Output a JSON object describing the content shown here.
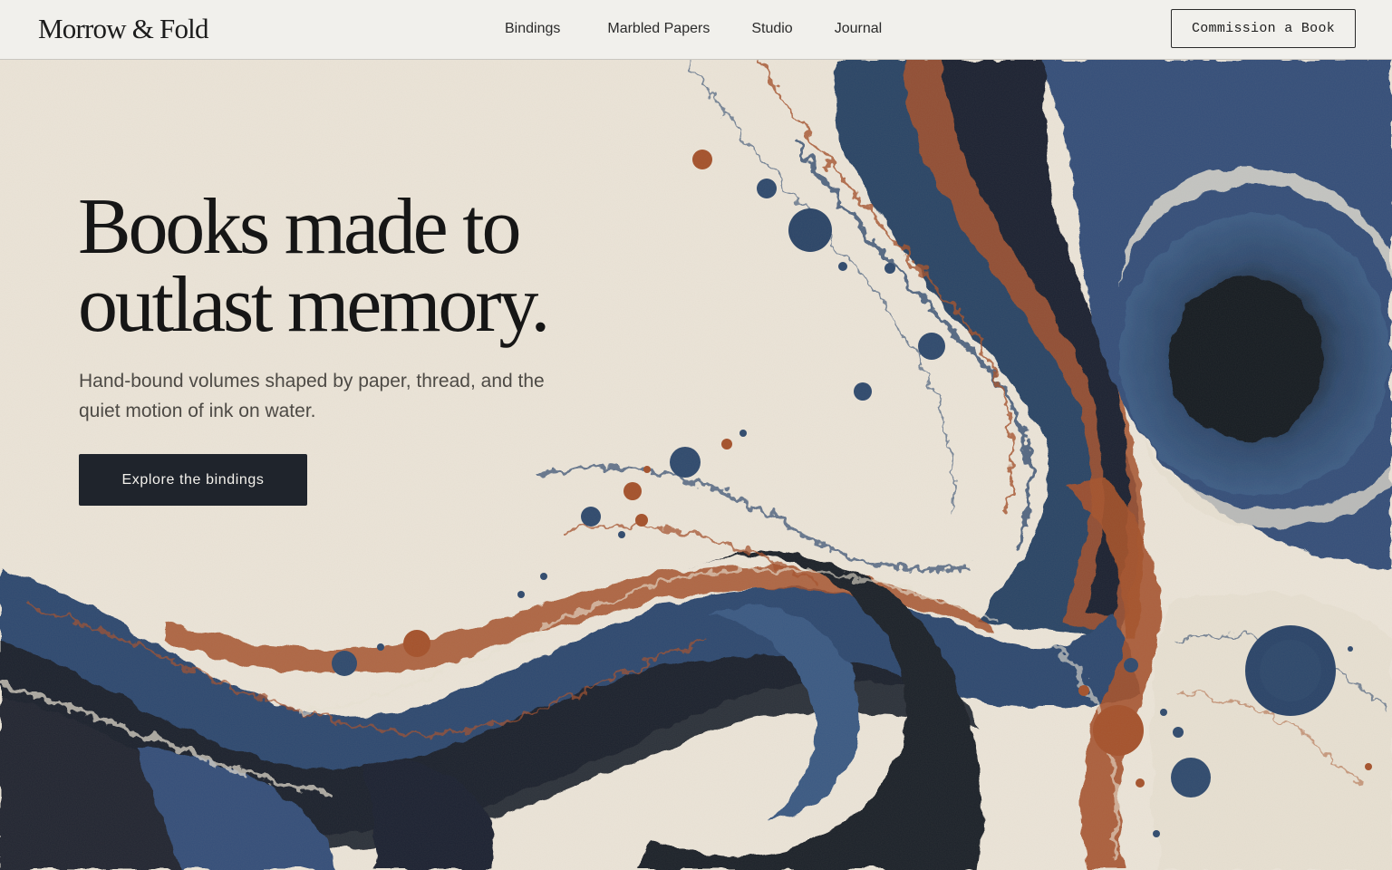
{
  "header": {
    "brand": "Morrow & Fold",
    "nav": [
      {
        "label": "Bindings"
      },
      {
        "label": "Marbled Papers"
      },
      {
        "label": "Studio"
      },
      {
        "label": "Journal"
      }
    ],
    "cta_label": "Commission a Book"
  },
  "hero": {
    "title_line_1": "Books made to",
    "title_line_2": "outlast memory.",
    "subtitle": "Hand-bound volumes shaped by paper, thread, and the quiet motion of ink on water.",
    "cta_label": "Explore the bindings",
    "background_art": "marbled-paper-swirl"
  },
  "colors": {
    "paper": "#ebe4d8",
    "header_bg": "#f1f0ec",
    "ink_navy": "#2f4a6e",
    "ink_black": "#1c1f26",
    "ink_rust": "#a5522c",
    "button_dark": "#1f242c"
  }
}
